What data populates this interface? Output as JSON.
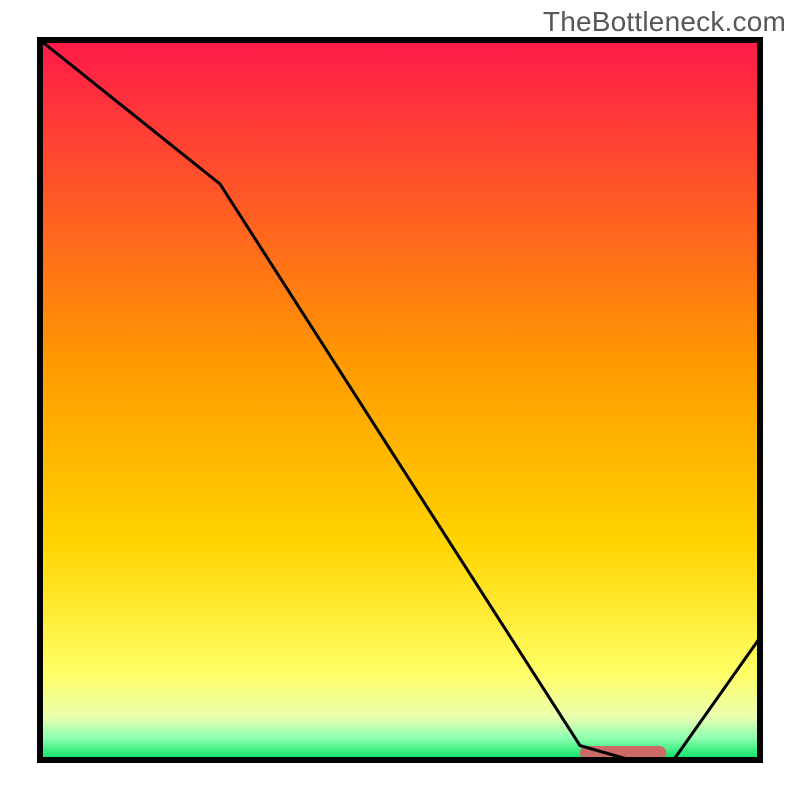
{
  "watermark": "TheBottleneck.com",
  "chart_data": {
    "type": "line",
    "title": "",
    "xlabel": "",
    "ylabel": "",
    "xlim": [
      0,
      100
    ],
    "ylim": [
      0,
      100
    ],
    "x": [
      0,
      25,
      75,
      82,
      88,
      100
    ],
    "values": [
      100,
      80,
      2,
      0,
      0,
      17
    ],
    "marker_segment": {
      "x_start": 75,
      "x_end": 87,
      "y": 0
    },
    "colors": {
      "gradient_top": "#ff1a4a",
      "gradient_mid": "#ffd400",
      "gradient_low_yellow": "#ffff80",
      "gradient_bottom": "#00e060",
      "marker": "#cc6b66",
      "line": "#000000",
      "frame": "#000000"
    }
  }
}
